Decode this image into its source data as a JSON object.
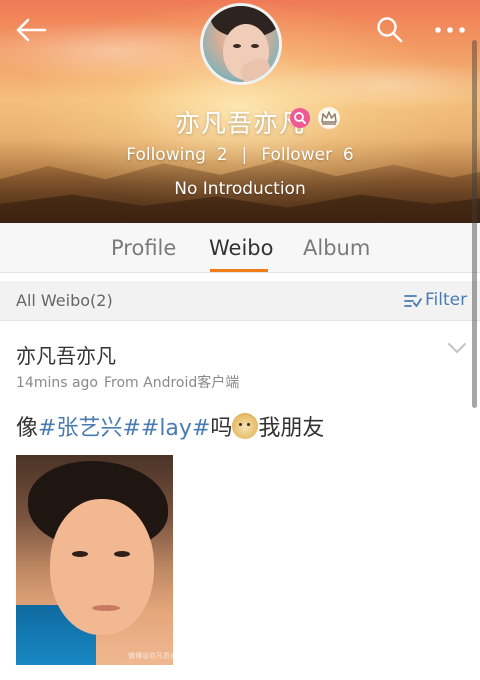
{
  "header": {
    "username": "亦凡吾亦凡",
    "following_label": "Following",
    "following_count": "2",
    "follower_label": "Follower",
    "follower_count": "6",
    "separator": "|",
    "introduction": "No Introduction",
    "icons": {
      "back": "back-arrow-icon",
      "search": "search-icon",
      "more": "more-dots-icon"
    }
  },
  "tabs": [
    {
      "label": "Profile",
      "active": false
    },
    {
      "label": "Weibo",
      "active": true
    },
    {
      "label": "Album",
      "active": false
    }
  ],
  "filter_bar": {
    "all_label": "All Weibo(2)",
    "filter_label": "Filter"
  },
  "post": {
    "author": "亦凡吾亦凡",
    "time": "14mins ago",
    "source": "From Android客户端",
    "text_prefix": "像",
    "tag1": "#张艺兴#",
    "tag2": "#lay#",
    "text_mid": "吗",
    "text_suffix": "我朋友",
    "watermark": "微博@亦凡吾亦凡"
  },
  "colors": {
    "accent": "#f07d19",
    "link": "#4a7bb3",
    "badge_pink": "#f05a93"
  }
}
